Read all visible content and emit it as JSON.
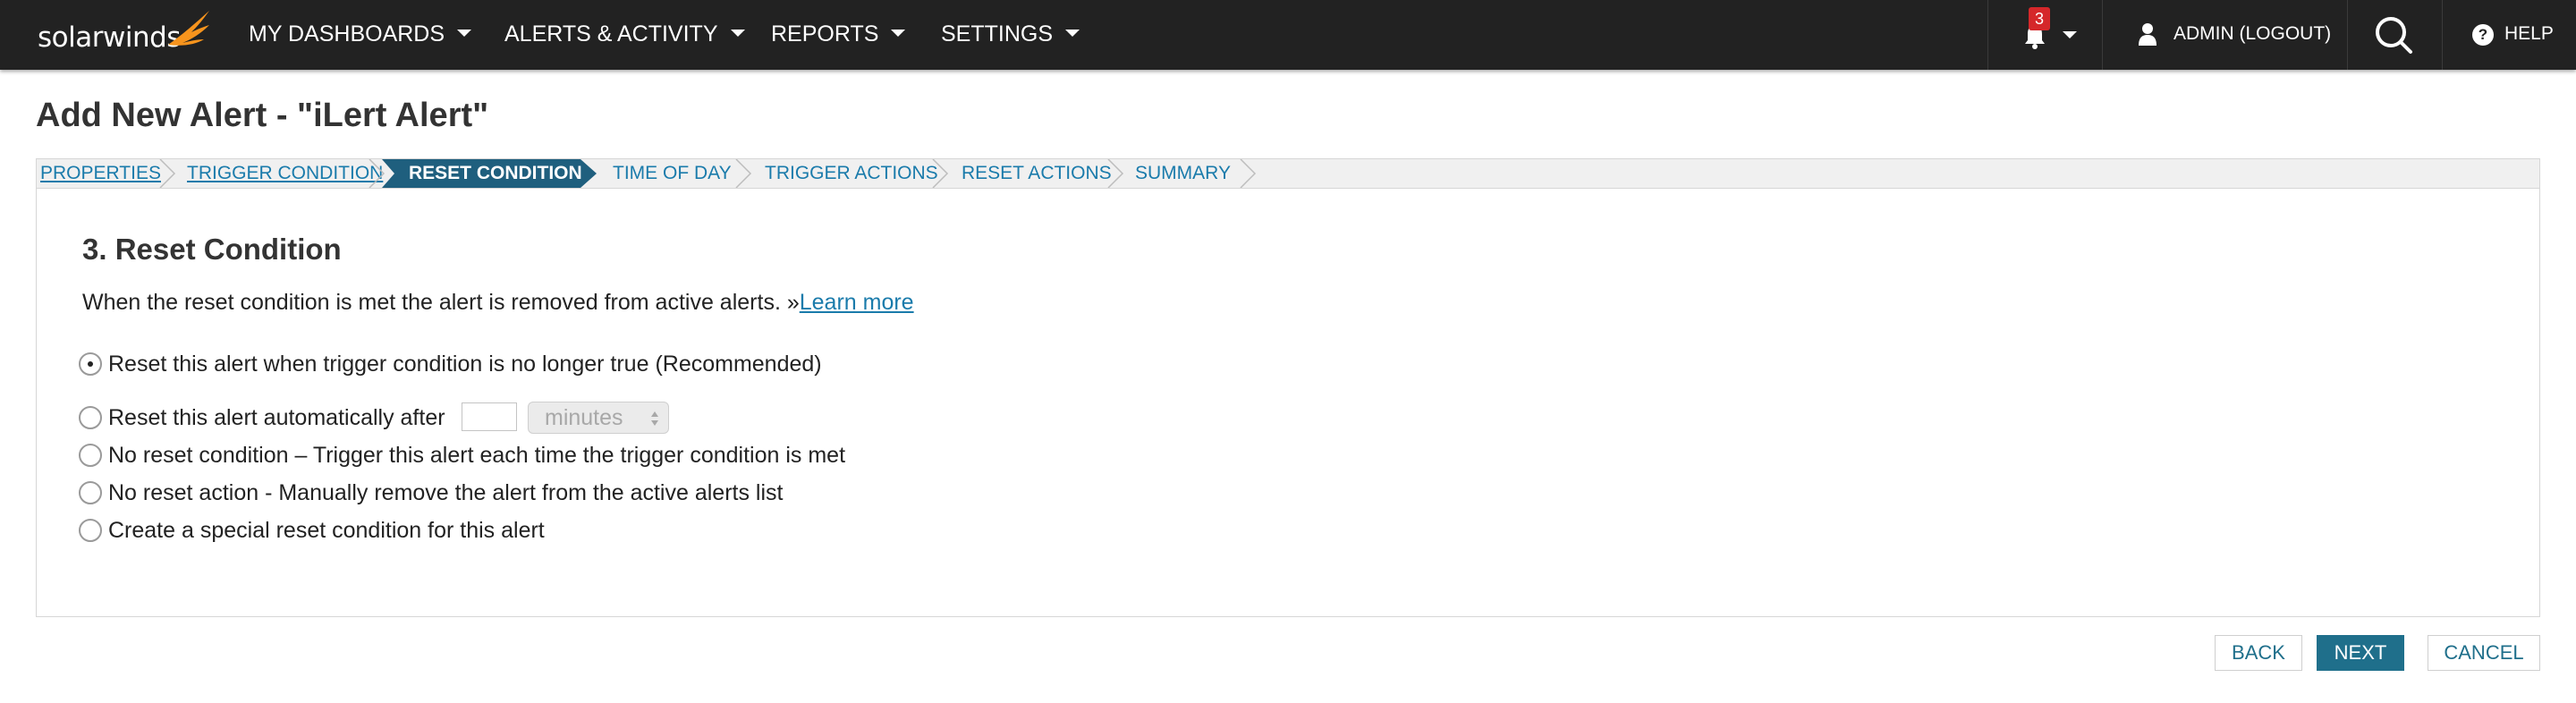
{
  "nav": {
    "logo": "solarwinds",
    "items": [
      {
        "label": "MY DASHBOARDS"
      },
      {
        "label": "ALERTS & ACTIVITY"
      },
      {
        "label": "REPORTS"
      },
      {
        "label": "SETTINGS"
      }
    ],
    "notifications_count": "3",
    "user_label": "ADMIN (LOGOUT)",
    "help_label": "HELP",
    "icons": [
      "bell-icon",
      "user-icon",
      "search-icon",
      "help-icon"
    ]
  },
  "page": {
    "title": "Add New Alert - \"iLert Alert\""
  },
  "steps": [
    {
      "label": "PROPERTIES",
      "state": "done"
    },
    {
      "label": "TRIGGER CONDITION",
      "state": "done"
    },
    {
      "label": "RESET CONDITION",
      "state": "active"
    },
    {
      "label": "TIME OF DAY",
      "state": "pending"
    },
    {
      "label": "TRIGGER ACTIONS",
      "state": "pending"
    },
    {
      "label": "RESET ACTIONS",
      "state": "pending"
    },
    {
      "label": "SUMMARY",
      "state": "pending"
    }
  ],
  "section": {
    "title": "3. Reset Condition",
    "description": "When the reset condition is met the alert is removed from active alerts. »",
    "learn_more": "Learn more"
  },
  "options": [
    {
      "label": "Reset this alert when trigger condition is no longer true (Recommended)",
      "selected": true
    },
    {
      "label": "Reset this alert automatically after",
      "selected": false
    },
    {
      "label": "No reset condition – Trigger this alert each time the trigger condition is met",
      "selected": false
    },
    {
      "label": "No reset action - Manually remove the alert from the active alerts list",
      "selected": false
    },
    {
      "label": "Create a special reset condition for this alert",
      "selected": false
    }
  ],
  "auto_reset": {
    "value": "",
    "unit": "minutes"
  },
  "buttons": {
    "back": "BACK",
    "next": "NEXT",
    "cancel": "CANCEL"
  },
  "colors": {
    "topbar": "#222222",
    "accent": "#1a7bab",
    "primary_button": "#1f6f8b",
    "active_step": "#1f5f7e",
    "logo_flame": "#f7941d",
    "badge": "#d5272a"
  }
}
